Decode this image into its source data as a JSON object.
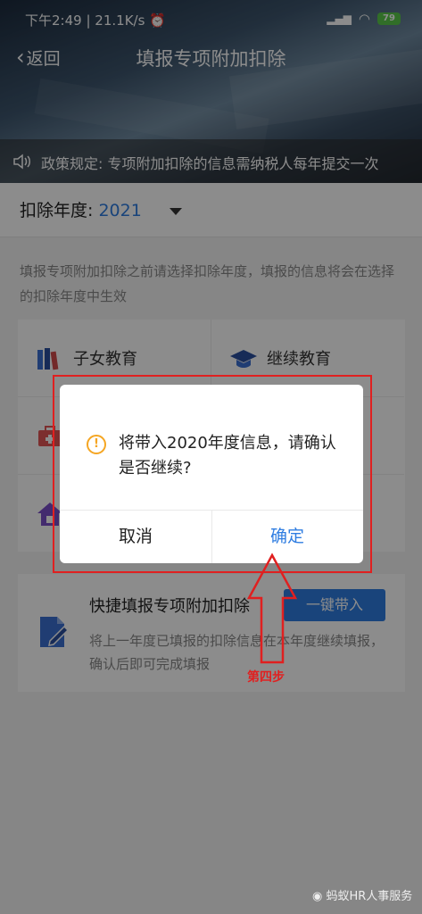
{
  "status": {
    "time": "下午2:49",
    "speed": "21.1K/s",
    "battery": "79"
  },
  "nav": {
    "back_label": "返回",
    "title": "填报专项附加扣除"
  },
  "notice": {
    "text": "政策规定: 专项附加扣除的信息需纳税人每年提交一次"
  },
  "year": {
    "label": "扣除年度:",
    "value": "2021"
  },
  "hint": "填报专项附加扣除之前请选择扣除年度，填报的信息将会在选择的扣除年度中生效",
  "categories": [
    {
      "label": "子女教育",
      "icon": "books-icon"
    },
    {
      "label": "继续教育",
      "icon": "graduation-cap-icon"
    }
  ],
  "quick": {
    "title": "快捷填报专项附加扣除",
    "button": "一键带入",
    "desc": "将上一年度已填报的扣除信息在本年度继续填报，确认后即可完成填报"
  },
  "dialog": {
    "message": "将带入2020年度信息，请确认是否继续?",
    "cancel": "取消",
    "confirm": "确定"
  },
  "annotation": {
    "step": "第四步"
  },
  "watermark": "蚂蚁HR人事服务",
  "colors": {
    "accent": "#2f7de1",
    "annotation": "#e02020",
    "warning": "#f5a623"
  }
}
